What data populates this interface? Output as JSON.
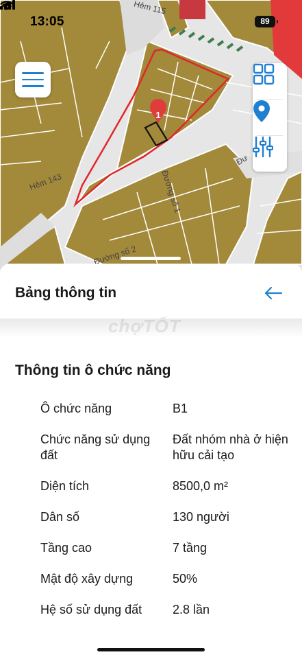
{
  "status_bar": {
    "time": "13:05",
    "battery": "89",
    "icons": [
      "location-arrow-icon",
      "signal-icon",
      "wifi-icon",
      "battery-icon"
    ]
  },
  "map": {
    "streets": [
      "Hẻm 115",
      "Hẻm 143",
      "Đường số 1",
      "Đường số 2",
      "Đư"
    ],
    "parcel_marker": "1",
    "highlight_color": "#e1262a",
    "land_color": "#a3893a",
    "road_color": "#e4e4e4",
    "buttons": [
      "menu-icon",
      "layers-grid-icon",
      "location-pin-icon",
      "filter-sliders-icon"
    ]
  },
  "panel": {
    "title": "Bảng thông tin",
    "back_icon": "arrow-left-icon",
    "watermark": "chợTỐT",
    "section_title": "Thông tin ô chức năng",
    "rows": [
      {
        "label": "Ô chức năng",
        "value": "B1"
      },
      {
        "label": "Chức năng sử dụng đất",
        "value": "Đất nhóm nhà ở hiện hữu cải tạo"
      },
      {
        "label": "Diện tích",
        "value": "8500,0 m²"
      },
      {
        "label": "Dân số",
        "value": "130 người"
      },
      {
        "label": "Tầng cao",
        "value": "7 tầng"
      },
      {
        "label": "Mật độ xây dựng",
        "value": "50%"
      },
      {
        "label": "Hệ số sử dụng đất",
        "value": "2.8 lần"
      }
    ],
    "accent_color": "#1f7fd1"
  }
}
